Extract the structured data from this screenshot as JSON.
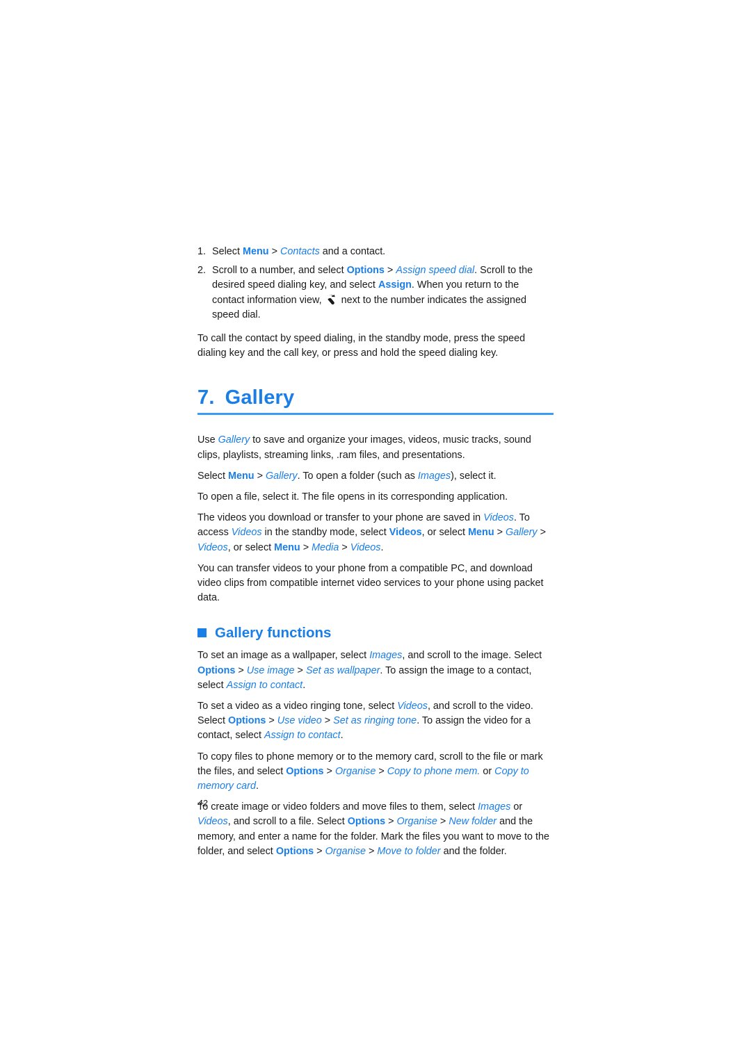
{
  "page": {
    "folio": "42",
    "accent_color": "#1a7ee8",
    "rule_color": "#3b9bf5",
    "text_color": "#1a1a1a"
  },
  "steps": [
    {
      "number": "1.",
      "parts": [
        {
          "text": "Select ",
          "style": "plain"
        },
        {
          "text": "Menu",
          "style": "key"
        },
        {
          "text": " > ",
          "style": "plain"
        },
        {
          "text": "Contacts",
          "style": "ui"
        },
        {
          "text": " and a contact.",
          "style": "plain"
        }
      ]
    },
    {
      "number": "2.",
      "parts": [
        {
          "text": "Scroll to a number, and select ",
          "style": "plain"
        },
        {
          "text": "Options",
          "style": "key"
        },
        {
          "text": " > ",
          "style": "plain"
        },
        {
          "text": "Assign speed dial",
          "style": "ui"
        },
        {
          "text": ". Scroll to the desired speed dialing key, and select ",
          "style": "plain"
        },
        {
          "text": "Assign",
          "style": "key"
        },
        {
          "text": ". When you return to the contact information view, ",
          "style": "plain"
        },
        {
          "text": "",
          "style": "icon",
          "icon": "speed-dial-icon"
        },
        {
          "text": " next to the number indicates the assigned speed dial.",
          "style": "plain"
        }
      ]
    }
  ],
  "intro_paragraph": {
    "parts": [
      {
        "text": "To call the contact by speed dialing, in the standby mode, press the speed dialing key and the call key, or press and hold the speed dialing key.",
        "style": "plain"
      }
    ]
  },
  "chapter": {
    "number": "7.",
    "title": "Gallery"
  },
  "body_paragraphs": [
    {
      "name": "gallery-overview",
      "parts": [
        {
          "text": "Use ",
          "style": "plain"
        },
        {
          "text": "Gallery",
          "style": "ui"
        },
        {
          "text": " to save and organize your images, videos, music tracks, sound clips, playlists, streaming links, .ram files, and presentations.",
          "style": "plain"
        }
      ]
    },
    {
      "name": "open-folder",
      "parts": [
        {
          "text": "Select ",
          "style": "plain"
        },
        {
          "text": "Menu",
          "style": "key"
        },
        {
          "text": " > ",
          "style": "plain"
        },
        {
          "text": "Gallery",
          "style": "ui"
        },
        {
          "text": ". To open a folder (such as ",
          "style": "plain"
        },
        {
          "text": "Images",
          "style": "ui"
        },
        {
          "text": "), select it.",
          "style": "plain"
        }
      ]
    },
    {
      "name": "open-file",
      "parts": [
        {
          "text": "To open a file, select it. The file opens in its corresponding application.",
          "style": "plain"
        }
      ]
    },
    {
      "name": "videos-access",
      "parts": [
        {
          "text": "The videos you download or transfer to your phone are saved in ",
          "style": "plain"
        },
        {
          "text": "Videos",
          "style": "ui"
        },
        {
          "text": ". To access ",
          "style": "plain"
        },
        {
          "text": "Videos",
          "style": "ui"
        },
        {
          "text": " in the standby mode, select ",
          "style": "plain"
        },
        {
          "text": "Videos",
          "style": "key"
        },
        {
          "text": ", or select ",
          "style": "plain"
        },
        {
          "text": "Menu",
          "style": "key"
        },
        {
          "text": " > ",
          "style": "plain"
        },
        {
          "text": "Gallery",
          "style": "ui"
        },
        {
          "text": " > ",
          "style": "plain"
        },
        {
          "text": "Videos",
          "style": "ui"
        },
        {
          "text": ", or select ",
          "style": "plain"
        },
        {
          "text": "Menu",
          "style": "key"
        },
        {
          "text": " > ",
          "style": "plain"
        },
        {
          "text": "Media",
          "style": "ui"
        },
        {
          "text": " > ",
          "style": "plain"
        },
        {
          "text": "Videos",
          "style": "ui"
        },
        {
          "text": ".",
          "style": "plain"
        }
      ]
    },
    {
      "name": "transfer-videos",
      "parts": [
        {
          "text": "You can transfer videos to your phone from a compatible PC, and download video clips from compatible internet video services to your phone using packet data.",
          "style": "plain"
        }
      ]
    }
  ],
  "section": {
    "title": "Gallery functions",
    "bullet": "square-bullet"
  },
  "section_paragraphs": [
    {
      "name": "set-wallpaper",
      "parts": [
        {
          "text": "To set an image as a wallpaper, select ",
          "style": "plain"
        },
        {
          "text": "Images",
          "style": "ui"
        },
        {
          "text": ", and scroll to the image. Select ",
          "style": "plain"
        },
        {
          "text": "Options",
          "style": "key"
        },
        {
          "text": " > ",
          "style": "plain"
        },
        {
          "text": "Use image",
          "style": "ui"
        },
        {
          "text": " > ",
          "style": "plain"
        },
        {
          "text": "Set as wallpaper",
          "style": "ui"
        },
        {
          "text": ". To assign the image to a contact, select ",
          "style": "plain"
        },
        {
          "text": "Assign to contact",
          "style": "ui"
        },
        {
          "text": ".",
          "style": "plain"
        }
      ]
    },
    {
      "name": "set-ringing-tone",
      "parts": [
        {
          "text": "To set a video as a video ringing tone, select ",
          "style": "plain"
        },
        {
          "text": "Videos",
          "style": "ui"
        },
        {
          "text": ", and scroll to the video. Select ",
          "style": "plain"
        },
        {
          "text": "Options",
          "style": "key"
        },
        {
          "text": " > ",
          "style": "plain"
        },
        {
          "text": "Use video",
          "style": "ui"
        },
        {
          "text": " > ",
          "style": "plain"
        },
        {
          "text": "Set as ringing tone",
          "style": "ui"
        },
        {
          "text": ". To assign the video for a contact, select ",
          "style": "plain"
        },
        {
          "text": "Assign to contact",
          "style": "ui"
        },
        {
          "text": ".",
          "style": "plain"
        }
      ]
    },
    {
      "name": "copy-files",
      "parts": [
        {
          "text": "To copy files to phone memory or to the memory card, scroll to the file or mark the files, and select ",
          "style": "plain"
        },
        {
          "text": "Options",
          "style": "key"
        },
        {
          "text": " > ",
          "style": "plain"
        },
        {
          "text": "Organise",
          "style": "ui"
        },
        {
          "text": " > ",
          "style": "plain"
        },
        {
          "text": "Copy to phone mem.",
          "style": "ui"
        },
        {
          "text": " or ",
          "style": "plain"
        },
        {
          "text": "Copy to memory card",
          "style": "ui"
        },
        {
          "text": ".",
          "style": "plain"
        }
      ]
    },
    {
      "name": "create-folders",
      "parts": [
        {
          "text": "To create image or video folders and move files to them, select ",
          "style": "plain"
        },
        {
          "text": "Images",
          "style": "ui"
        },
        {
          "text": " or ",
          "style": "plain"
        },
        {
          "text": "Videos",
          "style": "ui"
        },
        {
          "text": ", and scroll to a file. Select ",
          "style": "plain"
        },
        {
          "text": "Options",
          "style": "key"
        },
        {
          "text": " > ",
          "style": "plain"
        },
        {
          "text": "Organise",
          "style": "ui"
        },
        {
          "text": " > ",
          "style": "plain"
        },
        {
          "text": "New folder",
          "style": "ui"
        },
        {
          "text": " and the memory, and enter a name for the folder. Mark the files you want to move to the folder, and select ",
          "style": "plain"
        },
        {
          "text": "Options",
          "style": "key"
        },
        {
          "text": " > ",
          "style": "plain"
        },
        {
          "text": "Organise",
          "style": "ui"
        },
        {
          "text": " > ",
          "style": "plain"
        },
        {
          "text": "Move to folder",
          "style": "ui"
        },
        {
          "text": " and the folder.",
          "style": "plain"
        }
      ]
    }
  ]
}
